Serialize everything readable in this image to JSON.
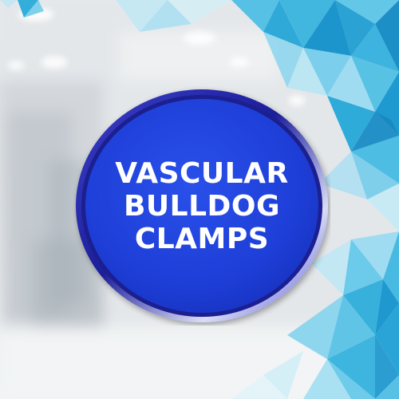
{
  "badge": {
    "lines": [
      "VASCULAR",
      "BULLDOG",
      "CLAMPS"
    ],
    "fill_color": "#1e3fd8",
    "ring_color": "#2a2fb8"
  },
  "colors": {
    "accent_cyan": "#2fb6de",
    "light_cyan": "#8fd9ef",
    "background": "#e3e6e9"
  }
}
